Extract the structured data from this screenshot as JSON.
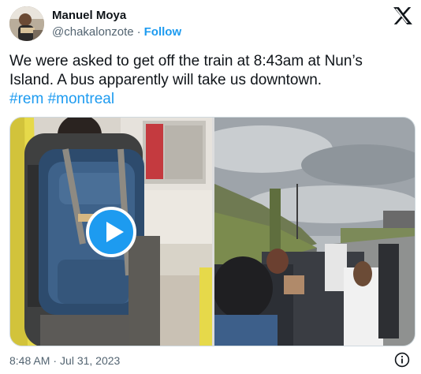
{
  "author": {
    "name": "Manuel Moya",
    "handle": "@chakalonzote",
    "separator": "·",
    "follow_label": "Follow"
  },
  "tweet": {
    "lines": [
      "We were asked to get off the train at 8:43am at Nun’s",
      "Island. A bus apparently will take us downtown."
    ],
    "hashtags": [
      "#rem",
      "#montreal"
    ]
  },
  "media": {
    "left_icon": "play-icon",
    "left_kind": "video",
    "right_kind": "photo"
  },
  "meta": {
    "time": "8:48 AM",
    "separator": "·",
    "date": "Jul 31, 2023"
  },
  "icons": {
    "brand": "x-logo-icon",
    "info": "info-icon"
  },
  "colors": {
    "accent": "#1d9bf0",
    "text": "#0f1419",
    "muted": "#536471",
    "border": "#cfd9de"
  }
}
